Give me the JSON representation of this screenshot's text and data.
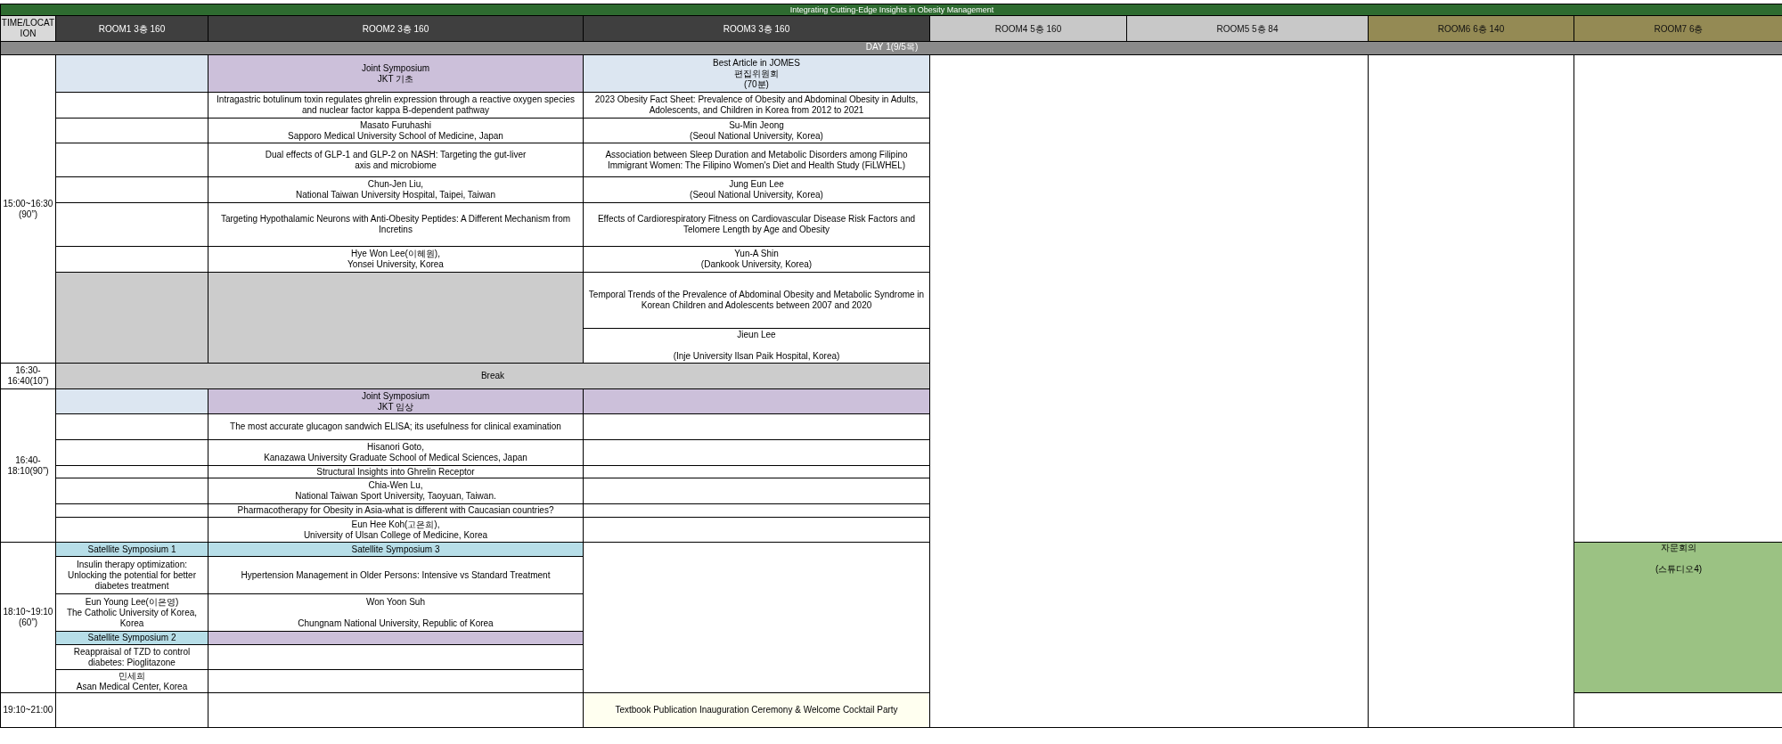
{
  "title": "Integrating Cutting-Edge Insights in Obesity Management",
  "corner": "TIME/LOCATION",
  "rooms": [
    {
      "label": "ROOM1 3층 160",
      "color": "#3f3f3f"
    },
    {
      "label": "ROOM2 3층 160",
      "color": "#3f3f3f"
    },
    {
      "label": "ROOM3 3층 160",
      "color": "#3f3f3f"
    },
    {
      "label": "ROOM4 5층 160",
      "color": "#c8c8c8"
    },
    {
      "label": "ROOM5 5층 84",
      "color": "#c8c8c8"
    },
    {
      "label": "ROOM6 6층 140",
      "color": "#948a54"
    },
    {
      "label": "ROOM7 6층",
      "color": "#948a54"
    }
  ],
  "day": "DAY 1(9/5목)",
  "sessions": [
    {
      "time": "15:00~16:30 (90”)",
      "cells": [
        {
          "kind": "heading"
        },
        {
          "kind": "symposium",
          "text": "Joint Symposium\nJKT 기초"
        },
        {
          "kind": "heading",
          "text": "Best Article in JOMES\n편집위원회\n(70분)"
        },
        {
          "kind": "blank"
        },
        {
          "kind": "blank"
        },
        {
          "kind": "blank"
        },
        {
          "kind": "blank"
        },
        {
          "kind": "talk",
          "text": "Intragastric botulinum toxin regulates ghrelin expression through a reactive oxygen species and nuclear factor kappa B-dependent pathway"
        },
        {
          "kind": "talk",
          "text": "2023 Obesity Fact Sheet: Prevalence of Obesity and Abdominal Obesity in Adults, Adolescents, and Children in Korea from 2012 to 2021"
        },
        {
          "kind": "blank"
        },
        {
          "kind": "speaker",
          "text": "Masato Furuhashi\nSapporo Medical University School of Medicine, Japan"
        },
        {
          "kind": "speaker",
          "text": "Su-Min Jeong\n(Seoul National University, Korea)"
        },
        {
          "kind": "blank"
        },
        {
          "kind": "talk",
          "text": "Dual effects of GLP-1 and GLP-2 on NASH: Targeting the gut-liver\naxis and microbiome"
        },
        {
          "kind": "talk",
          "text": "Association between Sleep Duration and Metabolic Disorders among Filipino Immigrant Women: The Filipino Women's Diet and Health Study (FiLWHEL)"
        },
        {
          "kind": "blank"
        },
        {
          "kind": "speaker",
          "text": "Chun-Jen Liu,\nNational Taiwan University Hospital, Taipei, Taiwan"
        },
        {
          "kind": "speaker",
          "text": "Jung Eun Lee\n(Seoul National University, Korea)"
        },
        {
          "kind": "blank"
        },
        {
          "kind": "talk",
          "text": "Targeting Hypothalamic Neurons with Anti-Obesity Peptides: A Different Mechanism from Incretins"
        },
        {
          "kind": "talk",
          "text": "Effects of Cardiorespiratory Fitness on Cardiovascular Disease Risk Factors and Telomere Length by Age and Obesity"
        },
        {
          "kind": "blank"
        },
        {
          "kind": "speaker",
          "text": "Hye Won Lee(이혜원),\nYonsei University, Korea"
        },
        {
          "kind": "speaker",
          "text": "Yun-A Shin\n(Dankook University, Korea)"
        },
        {
          "kind": "closed"
        },
        {
          "kind": "closed"
        },
        {
          "kind": "talk",
          "text": "Temporal Trends of the Prevalence of Abdominal Obesity and Metabolic Syndrome in Korean Children and Adolescents between 2007 and 2020"
        },
        {
          "kind": "speaker",
          "text": "Jieun Lee\n\n(Inje University Ilsan Paik Hospital, Korea)"
        }
      ]
    },
    {
      "time": "16:30-16:40(10”)",
      "cells": [
        {
          "kind": "break",
          "text": "Break"
        }
      ]
    },
    {
      "time": "16:40-18:10(90”)",
      "cells": [
        {
          "kind": "heading"
        },
        {
          "kind": "symposium",
          "text": "Joint Symposium\nJKT 임상"
        },
        {
          "kind": "symposium"
        },
        {
          "kind": "blank"
        },
        {
          "kind": "talk",
          "text": "The most accurate glucagon sandwich ELISA; its usefulness for clinical examination"
        },
        {
          "kind": "blank"
        },
        {
          "kind": "blank"
        },
        {
          "kind": "speaker",
          "text": "Hisanori Goto,\nKanazawa University Graduate School of Medical Sciences, Japan"
        },
        {
          "kind": "blank"
        },
        {
          "kind": "blank"
        },
        {
          "kind": "talk",
          "text": "Structural Insights into Ghrelin Receptor"
        },
        {
          "kind": "blank"
        },
        {
          "kind": "blank"
        },
        {
          "kind": "speaker",
          "text": "Chia-Wen Lu,\nNational Taiwan Sport University, Taoyuan, Taiwan."
        },
        {
          "kind": "blank"
        },
        {
          "kind": "blank"
        },
        {
          "kind": "talk",
          "text": "Pharmacotherapy for Obesity in Asia-what is different with Caucasian countries?"
        },
        {
          "kind": "blank"
        },
        {
          "kind": "blank"
        },
        {
          "kind": "speaker",
          "text": "Eun Hee Koh(고은희),\nUniversity of Ulsan College of Medicine, Korea"
        },
        {
          "kind": "blank"
        }
      ]
    },
    {
      "time": "18:10~19:10 (60”)",
      "cells": [
        {
          "kind": "satellite",
          "text": "Satellite Symposium 1"
        },
        {
          "kind": "satellite",
          "text": "Satellite Symposium 3"
        },
        {
          "kind": "blank"
        },
        {
          "kind": "meeting",
          "text": "자문회의\n\n(스튜디오4)"
        },
        {
          "kind": "talk",
          "text": "Insulin therapy optimization: Unlocking the potential for better diabetes treatment"
        },
        {
          "kind": "talk",
          "text": "Hypertension Management in Older Persons: Intensive vs Standard Treatment"
        },
        {
          "kind": "speaker",
          "text": "Eun Young Lee(이은영)\nThe Catholic University of Korea, Korea"
        },
        {
          "kind": "speaker",
          "text": "Won Yoon Suh\n\nChungnam National University, Republic of Korea"
        },
        {
          "kind": "satellite",
          "text": "Satellite Symposium 2"
        },
        {
          "kind": "symposium"
        },
        {
          "kind": "talk",
          "text": "Reappraisal of TZD to control diabetes: Pioglitazone"
        },
        {
          "kind": "blank"
        },
        {
          "kind": "speaker",
          "text": "민세희\nAsan Medical Center, Korea"
        },
        {
          "kind": "blank"
        }
      ]
    },
    {
      "time": "19:10~21:00",
      "cells": [
        {
          "kind": "blank"
        },
        {
          "kind": "blank"
        },
        {
          "kind": "event",
          "text": "Textbook Publication Inauguration Ceremony & Welcome Cocktail Party"
        },
        {
          "kind": "blank"
        }
      ]
    }
  ]
}
